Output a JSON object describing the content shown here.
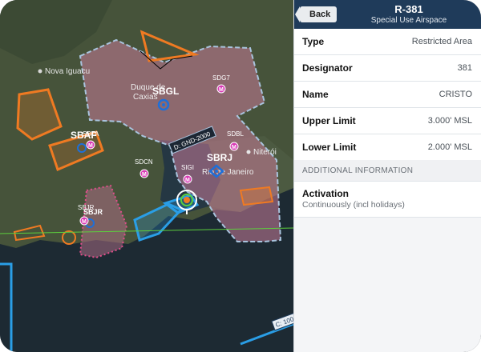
{
  "panel": {
    "back_label": "Back",
    "title": "R-381",
    "subtitle": "Special Use Airspace",
    "rows": [
      {
        "key": "Type",
        "value": "Restricted Area"
      },
      {
        "key": "Designator",
        "value": "381"
      },
      {
        "key": "Name",
        "value": "CRISTO"
      },
      {
        "key": "Upper Limit",
        "value": "3.000' MSL"
      },
      {
        "key": "Lower Limit",
        "value": "2.000' MSL"
      }
    ],
    "section_header": "ADDITIONAL INFORMATION",
    "activation": {
      "key": "Activation",
      "value": "Continuously (incl holidays)"
    }
  },
  "map": {
    "places": [
      "Nova Iguacu",
      "Duque de",
      "Caxias",
      "Niterói",
      "Rio de Janeiro"
    ],
    "airports": [
      "SBGL",
      "SBRJ",
      "SBAF",
      "SBJR"
    ],
    "points": [
      "SDG7",
      "SDBL",
      "SDCN",
      "SIGI",
      "SBFA",
      "SBJR"
    ],
    "airway_labels": [
      "D: GND-2000",
      "C: 100"
    ],
    "marker_letter": "M",
    "colors": {
      "land": "#3f4c33",
      "water": "#1d2a33",
      "restricted": "#c97c99",
      "airspace_border": "#a9c4de",
      "orange": "#ef7a22",
      "blue": "#2a9ee6",
      "header": "#1f3b5a"
    }
  }
}
